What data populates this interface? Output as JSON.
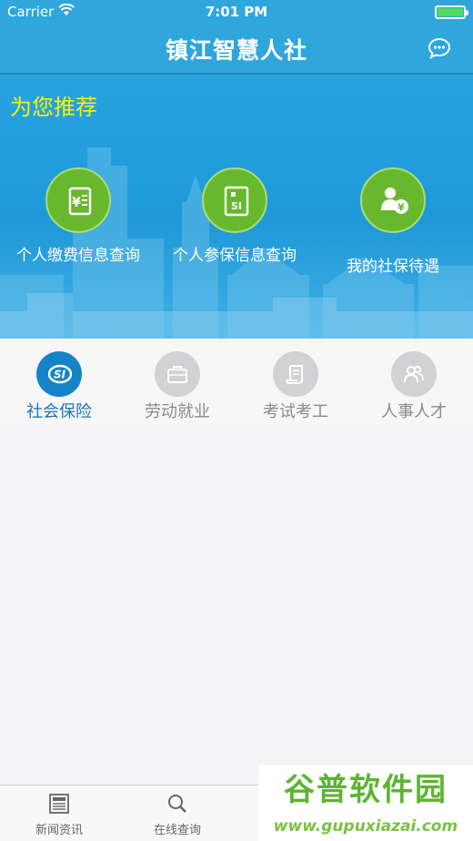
{
  "status_bar": {
    "carrier": "Carrier",
    "time": "7:01 PM"
  },
  "nav": {
    "title": "镇江智慧人社",
    "right_icon": "chat-bubble-icon"
  },
  "banner": {
    "heading": "为您推荐",
    "features": [
      {
        "label": "个人缴费信息查询",
        "icon": "yuan-document-icon"
      },
      {
        "label": "个人参保信息查询",
        "icon": "si-card-icon"
      },
      {
        "label": "我的社保待遇",
        "icon": "person-yuan-icon"
      }
    ]
  },
  "tabs": [
    {
      "label": "社会保险",
      "icon": "si-logo-icon",
      "active": true
    },
    {
      "label": "劳动就业",
      "icon": "briefcase-icon",
      "active": false
    },
    {
      "label": "考试考工",
      "icon": "scroll-icon",
      "active": false
    },
    {
      "label": "人事人才",
      "icon": "people-icon",
      "active": false
    }
  ],
  "tabbar": [
    {
      "label": "新闻资讯",
      "icon": "news-icon"
    },
    {
      "label": "在线查询",
      "icon": "search-icon"
    }
  ],
  "watermark": {
    "top": "谷普软件园",
    "bottom": "www.gupuxiazai.com"
  },
  "colors": {
    "primary": "#2fa6dc",
    "feature_green": "#68b82e",
    "highlight_yellow": "#fbf200",
    "tab_active": "#1583c8"
  }
}
